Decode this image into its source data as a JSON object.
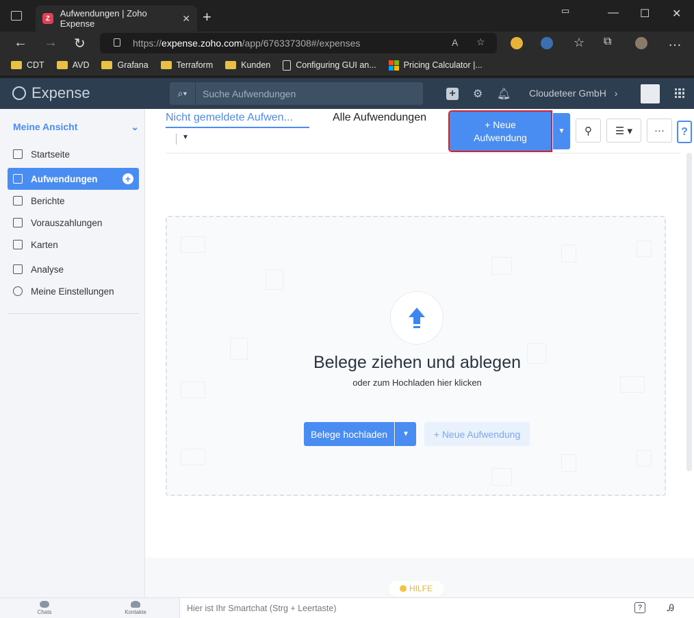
{
  "browser": {
    "tab_title": "Aufwendungen | Zoho Expense",
    "url_prefix": "https://",
    "url_host": "expense.zoho.com",
    "url_path": "/app/676337308#/expenses",
    "bookmarks": [
      {
        "label": "CDT",
        "icon": "folder-icon"
      },
      {
        "label": "AVD",
        "icon": "folder-icon"
      },
      {
        "label": "Grafana",
        "icon": "folder-icon"
      },
      {
        "label": "Terraform",
        "icon": "folder-icon"
      },
      {
        "label": "Kunden",
        "icon": "folder-icon"
      },
      {
        "label": "Configuring GUI an...",
        "icon": "document-icon"
      },
      {
        "label": "Pricing Calculator |...",
        "icon": "microsoft-icon"
      }
    ]
  },
  "header": {
    "brand": "Expense",
    "search_placeholder": "Suche Aufwendungen",
    "org_name": "Cloudeteer GmbH",
    "org_caret": "›"
  },
  "sidebar": {
    "view_title": "Meine Ansicht",
    "items": [
      {
        "label": "Startseite",
        "icon": "home-icon"
      },
      {
        "label": "Aufwendungen",
        "icon": "receipt-icon",
        "active": true
      },
      {
        "label": "Berichte",
        "icon": "folder-icon"
      },
      {
        "label": "Vorauszahlungen",
        "icon": "wallet-icon"
      },
      {
        "label": "Karten",
        "icon": "card-icon"
      },
      {
        "label": "Analyse",
        "icon": "chart-icon"
      },
      {
        "label": "Meine Einstellungen",
        "icon": "gear-icon"
      }
    ]
  },
  "main": {
    "tabs": [
      {
        "label": "Nicht gemeldete Aufwen...",
        "active": true
      },
      {
        "label": "Alle Aufwendungen",
        "active": false
      }
    ],
    "new_button_plus": "+",
    "new_button_line1": "Neue",
    "new_button_line2": "Aufwendung",
    "dropzone_title": "Belege ziehen und ablegen",
    "dropzone_subtitle": "oder zum Hochladen hier klicken",
    "upload_button": "Belege hochladen",
    "new_expense_button": "+ Neue Aufwendung",
    "help_label": "HILFE"
  },
  "bottombar": {
    "chats": "Chats",
    "contacts": "Kontakte",
    "smartchat_placeholder": "Hier ist Ihr Smartchat (Strg + Leertaste)"
  },
  "colors": {
    "accent": "#4a8df2",
    "header_bg": "#2d3e50",
    "highlight": "#d2232a"
  }
}
